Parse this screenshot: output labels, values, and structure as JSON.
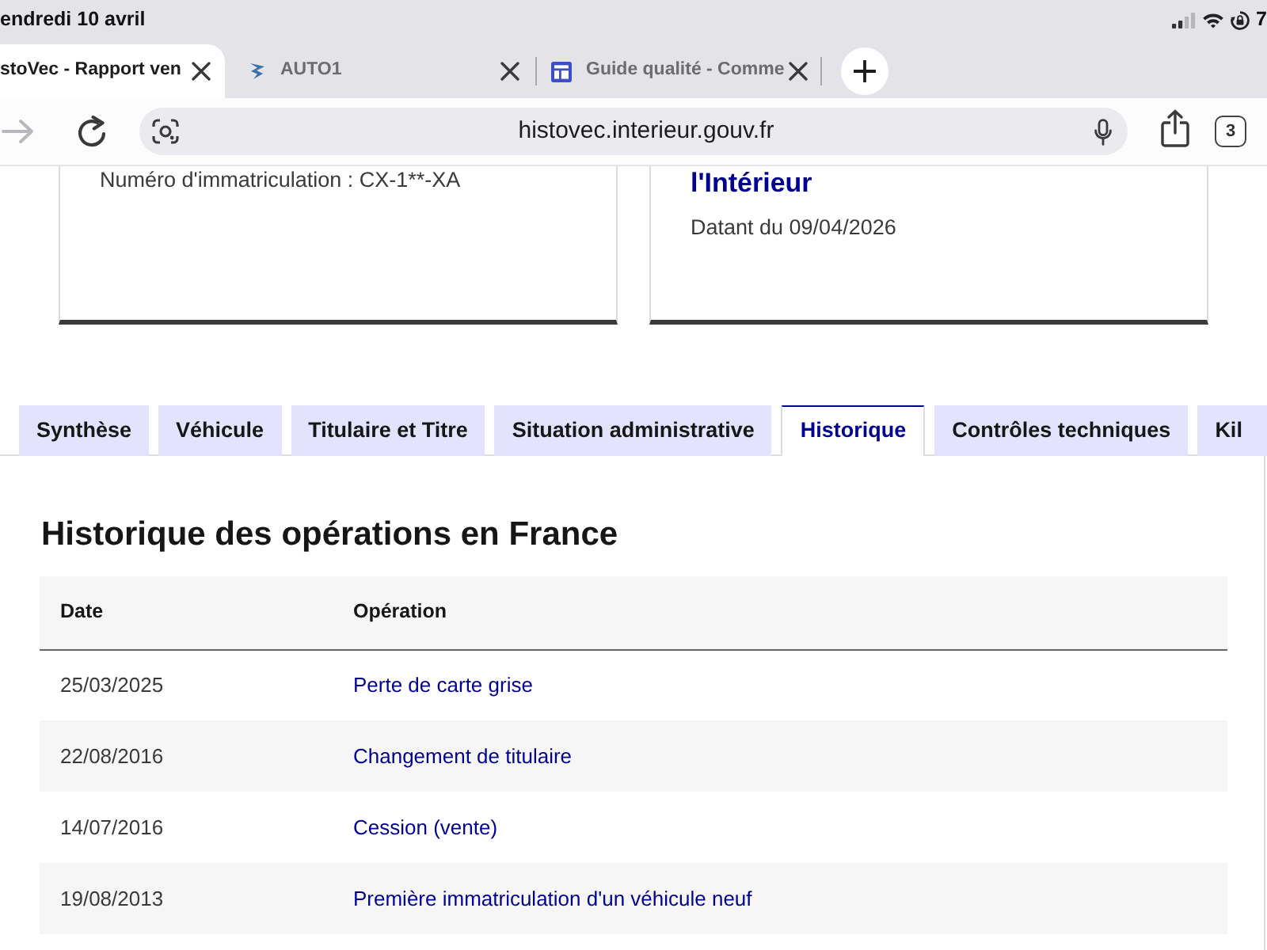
{
  "status_bar": {
    "date": "endredi 10 avril",
    "battery": "7"
  },
  "browser_tabs": [
    {
      "kind": "plain",
      "title": "stoVec - Rapport ven",
      "selected": true
    },
    {
      "kind": "logo",
      "title": "AUTO1",
      "selected": false
    },
    {
      "kind": "layout",
      "title": "Guide qualité - Comme",
      "selected": false
    }
  ],
  "toolbar": {
    "forward_disabled": true,
    "url": "histovec.interieur.gouv.fr",
    "tab_count": "3"
  },
  "cards": [
    {
      "text": "Numéro d'immatriculation : CX-1**-XA"
    },
    {
      "title": "l'Intérieur",
      "text": "Datant du 09/04/2026"
    }
  ],
  "section_tabs": [
    {
      "label": "Synthèse",
      "selected": false
    },
    {
      "label": "Véhicule",
      "selected": false
    },
    {
      "label": "Titulaire et Titre",
      "selected": false
    },
    {
      "label": "Situation administrative",
      "selected": false
    },
    {
      "label": "Historique",
      "selected": true
    },
    {
      "label": "Contrôles techniques",
      "selected": false
    },
    {
      "label": "Kil",
      "selected": false
    }
  ],
  "history": {
    "heading": "Historique des opérations en France",
    "columns": [
      "Date",
      "Opération"
    ],
    "rows": [
      {
        "date": "25/03/2025",
        "operation": "Perte de carte grise"
      },
      {
        "date": "22/08/2016",
        "operation": "Changement de titulaire"
      },
      {
        "date": "14/07/2016",
        "operation": "Cession (vente)"
      },
      {
        "date": "19/08/2013",
        "operation": "Première immatriculation d'un véhicule neuf"
      }
    ]
  }
}
